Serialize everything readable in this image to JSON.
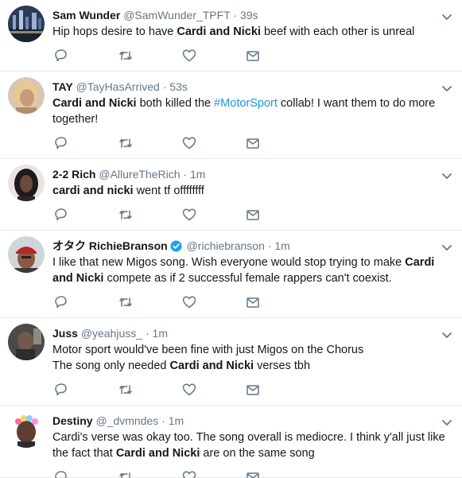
{
  "tweets": [
    {
      "name": "Sam Wunder",
      "handle": "@SamWunder_TPFT",
      "separator": "·",
      "time": "39s",
      "verified": false,
      "avatar": "city-night-avatar",
      "segments": [
        {
          "text": "Hip hops desire to have ",
          "style": "plain"
        },
        {
          "text": "Cardi and Nicki",
          "style": "bold"
        },
        {
          "text": " beef with each other is unreal",
          "style": "plain"
        }
      ]
    },
    {
      "name": "TAY",
      "handle": "@TayHasArrived",
      "separator": "·",
      "time": "53s",
      "verified": false,
      "avatar": "woman-blonde-avatar",
      "segments": [
        {
          "text": "Cardi and Nicki",
          "style": "bold"
        },
        {
          "text": " both killed the ",
          "style": "plain"
        },
        {
          "text": "#MotorSport",
          "style": "hashtag"
        },
        {
          "text": " collab! I want them to do more together!",
          "style": "plain"
        }
      ]
    },
    {
      "name": "2-2 Rich",
      "handle": "@AllureTheRich",
      "separator": "·",
      "time": "1m",
      "verified": false,
      "avatar": "woman-dark-hair-avatar",
      "segments": [
        {
          "text": "cardi and nicki",
          "style": "bold"
        },
        {
          "text": " went tf offffffff",
          "style": "plain"
        }
      ]
    },
    {
      "name": "オタク RichieBranson",
      "handle": "@richiebranson",
      "separator": "·",
      "time": "1m",
      "verified": true,
      "avatar": "man-red-cap-avatar",
      "segments": [
        {
          "text": "I like that new Migos song. Wish everyone would stop trying to make ",
          "style": "plain"
        },
        {
          "text": "Cardi and Nicki",
          "style": "bold"
        },
        {
          "text": " compete as if 2 successful female rappers can't coexist.",
          "style": "plain"
        }
      ]
    },
    {
      "name": "Juss",
      "handle": "@yeahjuss_",
      "separator": "·",
      "time": "1m",
      "verified": false,
      "avatar": "man-dark-photo-avatar",
      "segments": [
        {
          "text": "Motor sport would've been fine with just Migos on the Chorus",
          "style": "plain"
        },
        {
          "text": "\n",
          "style": "break"
        },
        {
          "text": "The song only needed ",
          "style": "plain"
        },
        {
          "text": "Cardi and Nicki",
          "style": "bold"
        },
        {
          "text": " verses tbh",
          "style": "plain"
        }
      ]
    },
    {
      "name": "Destiny",
      "handle": "@_dvmndes",
      "separator": "·",
      "time": "1m",
      "verified": false,
      "avatar": "woman-flower-crown-avatar",
      "segments": [
        {
          "text": "Cardi's verse was okay too. The song overall is mediocre. I think y'all just like the fact that ",
          "style": "plain"
        },
        {
          "text": "Cardi and Nicki",
          "style": "bold"
        },
        {
          "text": " are on the same song",
          "style": "plain"
        }
      ]
    }
  ],
  "actions": [
    "reply-icon",
    "retweet-icon",
    "like-icon",
    "message-icon"
  ],
  "colors": {
    "text": "#14171a",
    "secondary": "#657786",
    "link": "#1b95e0",
    "border": "#e6ecf0",
    "verified": "#1da1f2"
  }
}
